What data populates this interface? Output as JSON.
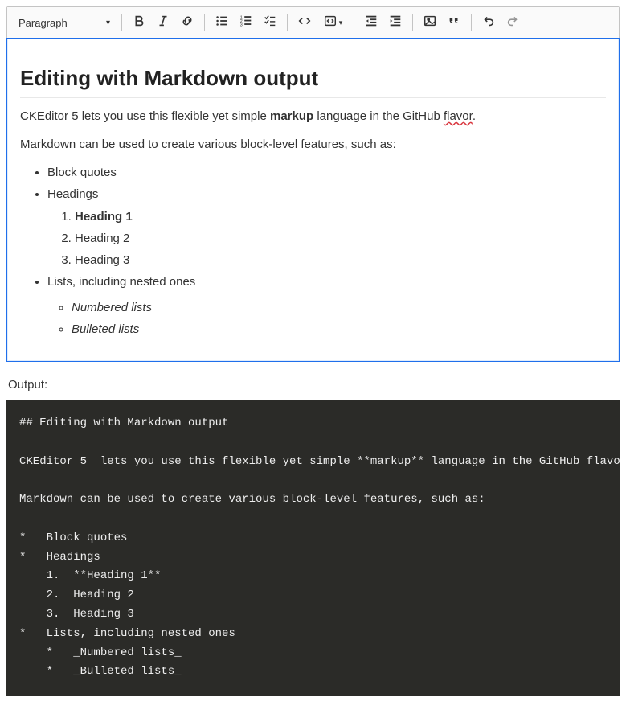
{
  "toolbar": {
    "heading_select": "Paragraph"
  },
  "content": {
    "h2": "Editing with Markdown output",
    "p1_a": "CKEditor 5  lets you use this flexible yet simple ",
    "p1_markup": "markup",
    "p1_b": " language in the GitHub ",
    "p1_flavor": "flavor",
    "p1_c": ".",
    "p2": "Markdown can be used to create various block-level features, such as:",
    "li_block_quotes": "Block quotes",
    "li_headings": "Headings",
    "li_h1": "Heading 1",
    "li_h2": "Heading 2",
    "li_h3": "Heading 3",
    "li_lists": "Lists, including nested ones",
    "li_numbered": "Numbered lists",
    "li_bulleted": "Bulleted lists"
  },
  "output_label": "Output:",
  "output_text": "## Editing with Markdown output\n\nCKEditor 5  lets you use this flexible yet simple **markup** language in the GitHub flavor.\n\nMarkdown can be used to create various block-level features, such as:\n\n*   Block quotes\n*   Headings\n    1.  **Heading 1**\n    2.  Heading 2\n    3.  Heading 3\n*   Lists, including nested ones\n    *   _Numbered lists_\n    *   _Bulleted lists_"
}
